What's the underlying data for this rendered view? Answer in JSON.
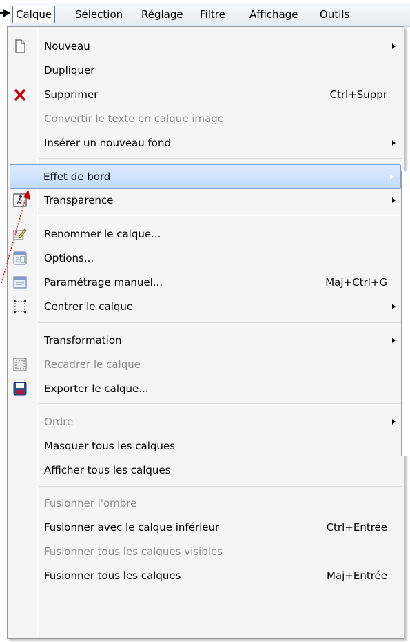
{
  "menubar": {
    "items": [
      {
        "label": "Calque",
        "active": true
      },
      {
        "label": "Sélection"
      },
      {
        "label": "Réglage"
      },
      {
        "label": "Filtre"
      },
      {
        "label": "Affichage"
      },
      {
        "label": "Outils"
      }
    ]
  },
  "menu": {
    "items": [
      {
        "label": "Nouveau",
        "icon": "new-page-icon",
        "submenu": true
      },
      {
        "label": "Dupliquer"
      },
      {
        "label": "Supprimer",
        "icon": "delete-x-icon",
        "shortcut": "Ctrl+Suppr"
      },
      {
        "label": "Convertir le texte en calque image",
        "disabled": true
      },
      {
        "label": "Insérer un nouveau fond",
        "submenu": true
      },
      {
        "label": "Effet de bord",
        "submenu": true,
        "highlighted": true
      },
      {
        "label": "Transparence",
        "icon": "transparency-icon",
        "submenu": true
      },
      {
        "label": "Renommer le calque...",
        "icon": "rename-pencil-icon"
      },
      {
        "label": "Options...",
        "icon": "options-window-icon"
      },
      {
        "label": "Paramétrage manuel...",
        "icon": "manual-settings-icon",
        "shortcut": "Maj+Ctrl+G"
      },
      {
        "label": "Centrer le calque",
        "icon": "center-layer-icon",
        "submenu": true
      },
      {
        "label": "Transformation",
        "submenu": true
      },
      {
        "label": "Recadrer le calque",
        "icon": "crop-layer-icon",
        "disabled": true
      },
      {
        "label": "Exporter le calque...",
        "icon": "save-disk-icon"
      },
      {
        "label": "Ordre",
        "disabled": true,
        "submenu": true
      },
      {
        "label": "Masquer tous les calques"
      },
      {
        "label": "Afficher tous les calques"
      },
      {
        "label": "Fusionner l'ombre",
        "disabled": true
      },
      {
        "label": "Fusionner avec le calque inférieur",
        "shortcut": "Ctrl+Entrée"
      },
      {
        "label": "Fusionner tous les calques visibles",
        "disabled": true
      },
      {
        "label": "Fusionner tous les calques",
        "shortcut": "Maj+Entrée"
      }
    ]
  },
  "colors": {
    "menubar_bg": "#e9eef5",
    "highlight": "#c9e0fb",
    "delete_x": "#d40000",
    "annotation_arrow": "#cc0000"
  }
}
